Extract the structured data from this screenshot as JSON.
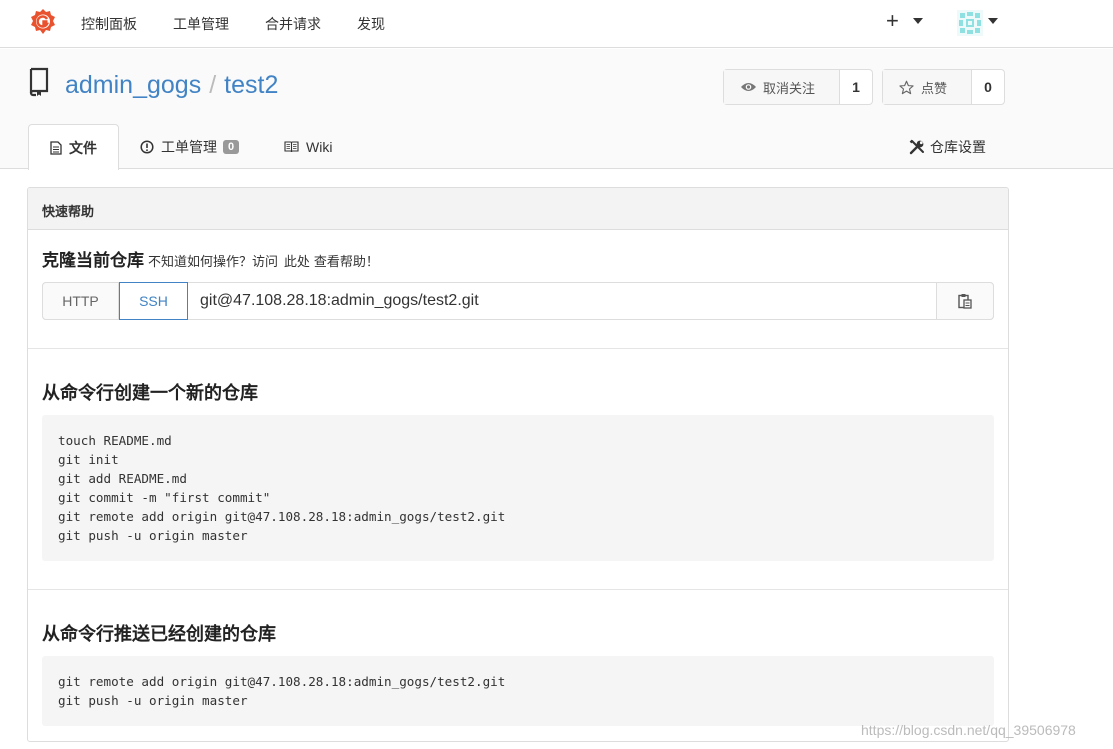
{
  "nav": {
    "links": [
      "控制面板",
      "工单管理",
      "合并请求",
      "发现"
    ],
    "plus_symbol": "+"
  },
  "repo": {
    "owner": "admin_gogs",
    "separator": "/",
    "name": "test2",
    "watch_label": "取消关注",
    "watch_count": "1",
    "star_label": "点赞",
    "star_count": "0"
  },
  "tabs": {
    "files": "文件",
    "issues": "工单管理",
    "issues_count": "0",
    "wiki": "Wiki",
    "settings": "仓库设置"
  },
  "quick_help": {
    "header": "快速帮助",
    "clone_title": "克隆当前仓库",
    "hint_prefix": "不知道如何操作？访问",
    "hint_link": "此处",
    "hint_suffix": "查看帮助！",
    "http_label": "HTTP",
    "ssh_label": "SSH",
    "clone_url": "git@47.108.28.18:admin_gogs/test2.git",
    "new_repo_title": "从命令行创建一个新的仓库",
    "new_repo_commands": [
      "touch README.md",
      "git init",
      "git add README.md",
      "git commit -m \"first commit\"",
      "git remote add origin git@47.108.28.18:admin_gogs/test2.git",
      "git push -u origin master"
    ],
    "push_existing_title": "从命令行推送已经创建的仓库",
    "push_existing_commands": [
      "git remote add origin git@47.108.28.18:admin_gogs/test2.git",
      "git push -u origin master"
    ]
  },
  "watermark": "https://blog.csdn.net/qq_39506978",
  "colors": {
    "link": "#4183c4",
    "logo": "#e9522e"
  }
}
